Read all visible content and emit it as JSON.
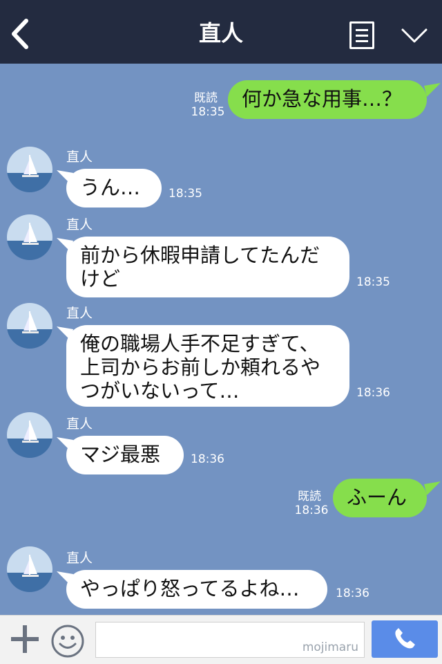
{
  "header": {
    "title": "直人",
    "back_icon": "chevron-left-icon",
    "menu_icon": "list-icon",
    "collapse_icon": "chevron-down-icon"
  },
  "messages": [
    {
      "side": "right",
      "text": "何か急な用事…？",
      "read": "既読",
      "time": "18:35"
    },
    {
      "side": "left",
      "name": "直人",
      "lines": [
        "うん…"
      ],
      "time": "18:35"
    },
    {
      "side": "left",
      "name": "直人",
      "lines": [
        "前から休暇申請してたんだ",
        "けど"
      ],
      "time": "18:35"
    },
    {
      "side": "left",
      "name": "直人",
      "lines": [
        "俺の職場人手不足すぎて、",
        "上司からお前しか頼れるや",
        "つがいないって…"
      ],
      "time": "18:36"
    },
    {
      "side": "left",
      "name": "直人",
      "lines": [
        "マジ最悪"
      ],
      "time": "18:36"
    },
    {
      "side": "right",
      "text": "ふーん",
      "read": "既読",
      "time": "18:36"
    },
    {
      "side": "left",
      "name": "直人",
      "lines": [
        "やっぱり怒ってるよね…"
      ],
      "time": "18:36"
    }
  ],
  "input": {
    "add_icon": "plus-icon",
    "sticker_icon": "smiley-icon",
    "watermark": "mojimaru",
    "call_icon": "phone-icon"
  },
  "colors": {
    "header_bg": "#232b40",
    "chat_bg": "#7393c2",
    "right_bubble": "#86de4c",
    "left_bubble": "#ffffff",
    "call_button": "#5a8ce8"
  }
}
